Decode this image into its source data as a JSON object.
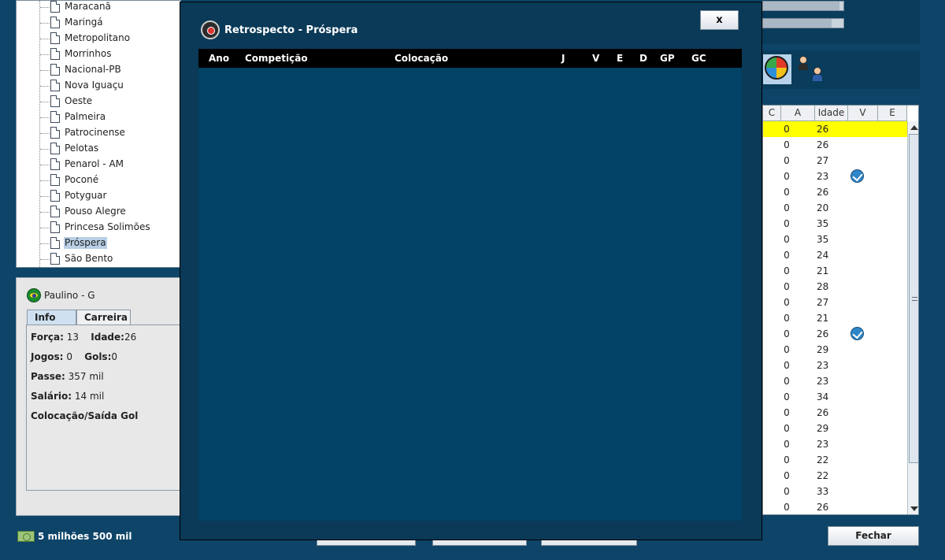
{
  "tree": {
    "items": [
      {
        "label": "Maracanã",
        "selected": false
      },
      {
        "label": "Maringá",
        "selected": false
      },
      {
        "label": "Metropolitano",
        "selected": false
      },
      {
        "label": "Morrinhos",
        "selected": false
      },
      {
        "label": "Nacional-PB",
        "selected": false
      },
      {
        "label": "Nova Iguaçu",
        "selected": false
      },
      {
        "label": "Oeste",
        "selected": false
      },
      {
        "label": "Palmeira",
        "selected": false
      },
      {
        "label": "Patrocinense",
        "selected": false
      },
      {
        "label": "Pelotas",
        "selected": false
      },
      {
        "label": "Penarol - AM",
        "selected": false
      },
      {
        "label": "Poconé",
        "selected": false
      },
      {
        "label": "Potyguar",
        "selected": false
      },
      {
        "label": "Pouso Alegre",
        "selected": false
      },
      {
        "label": "Princesa Solimões",
        "selected": false
      },
      {
        "label": "Próspera",
        "selected": true
      },
      {
        "label": "São Bento",
        "selected": false
      }
    ]
  },
  "player": {
    "name": "Paulino - G",
    "flag_icon": "brazil-flag-icon",
    "tabs": {
      "info": "Info",
      "career": "Carreira"
    },
    "forca_label": "Força:",
    "forca_value": "13",
    "idade_label": "Idade:",
    "idade_value": "26",
    "jogos_label": "Jogos:",
    "jogos_value": "0",
    "gols_label": "Gols:",
    "gols_value": "0",
    "passe_label": "Passe:",
    "passe_value": "357 mil",
    "salario_label": "Salário:",
    "salario_value": "14 mil",
    "skill": "Colocação/Saída Gol"
  },
  "money": {
    "amount": "5 milhões 500 mil"
  },
  "squad_table": {
    "headers": {
      "c": "C",
      "a": "A",
      "idade": "Idade",
      "v": "V",
      "e": "E"
    },
    "rows": [
      {
        "a": "0",
        "idade": "26",
        "v": false,
        "highlight": true
      },
      {
        "a": "0",
        "idade": "26",
        "v": false
      },
      {
        "a": "0",
        "idade": "27",
        "v": false
      },
      {
        "a": "0",
        "idade": "23",
        "v": true
      },
      {
        "a": "0",
        "idade": "26",
        "v": false
      },
      {
        "a": "0",
        "idade": "20",
        "v": false
      },
      {
        "a": "0",
        "idade": "35",
        "v": false
      },
      {
        "a": "0",
        "idade": "35",
        "v": false
      },
      {
        "a": "0",
        "idade": "24",
        "v": false
      },
      {
        "a": "0",
        "idade": "21",
        "v": false
      },
      {
        "a": "0",
        "idade": "28",
        "v": false
      },
      {
        "a": "0",
        "idade": "27",
        "v": false
      },
      {
        "a": "0",
        "idade": "21",
        "v": false
      },
      {
        "a": "0",
        "idade": "26",
        "v": true
      },
      {
        "a": "0",
        "idade": "29",
        "v": false
      },
      {
        "a": "0",
        "idade": "23",
        "v": false
      },
      {
        "a": "0",
        "idade": "23",
        "v": false
      },
      {
        "a": "0",
        "idade": "34",
        "v": false
      },
      {
        "a": "0",
        "idade": "26",
        "v": false
      },
      {
        "a": "0",
        "idade": "29",
        "v": false
      },
      {
        "a": "0",
        "idade": "23",
        "v": false
      },
      {
        "a": "0",
        "idade": "22",
        "v": false
      },
      {
        "a": "0",
        "idade": "22",
        "v": false
      },
      {
        "a": "0",
        "idade": "33",
        "v": false
      },
      {
        "a": "0",
        "idade": "26",
        "v": false
      }
    ]
  },
  "buttons": {
    "fechar": "Fechar"
  },
  "modal": {
    "title": "Retrospecto - Próspera",
    "close_label": "x",
    "columns": {
      "ano": "Ano",
      "competicao": "Competição",
      "colocacao": "Colocação",
      "j": "J",
      "v": "V",
      "e": "E",
      "d": "D",
      "gp": "GP",
      "gc": "GC"
    },
    "rows": []
  }
}
